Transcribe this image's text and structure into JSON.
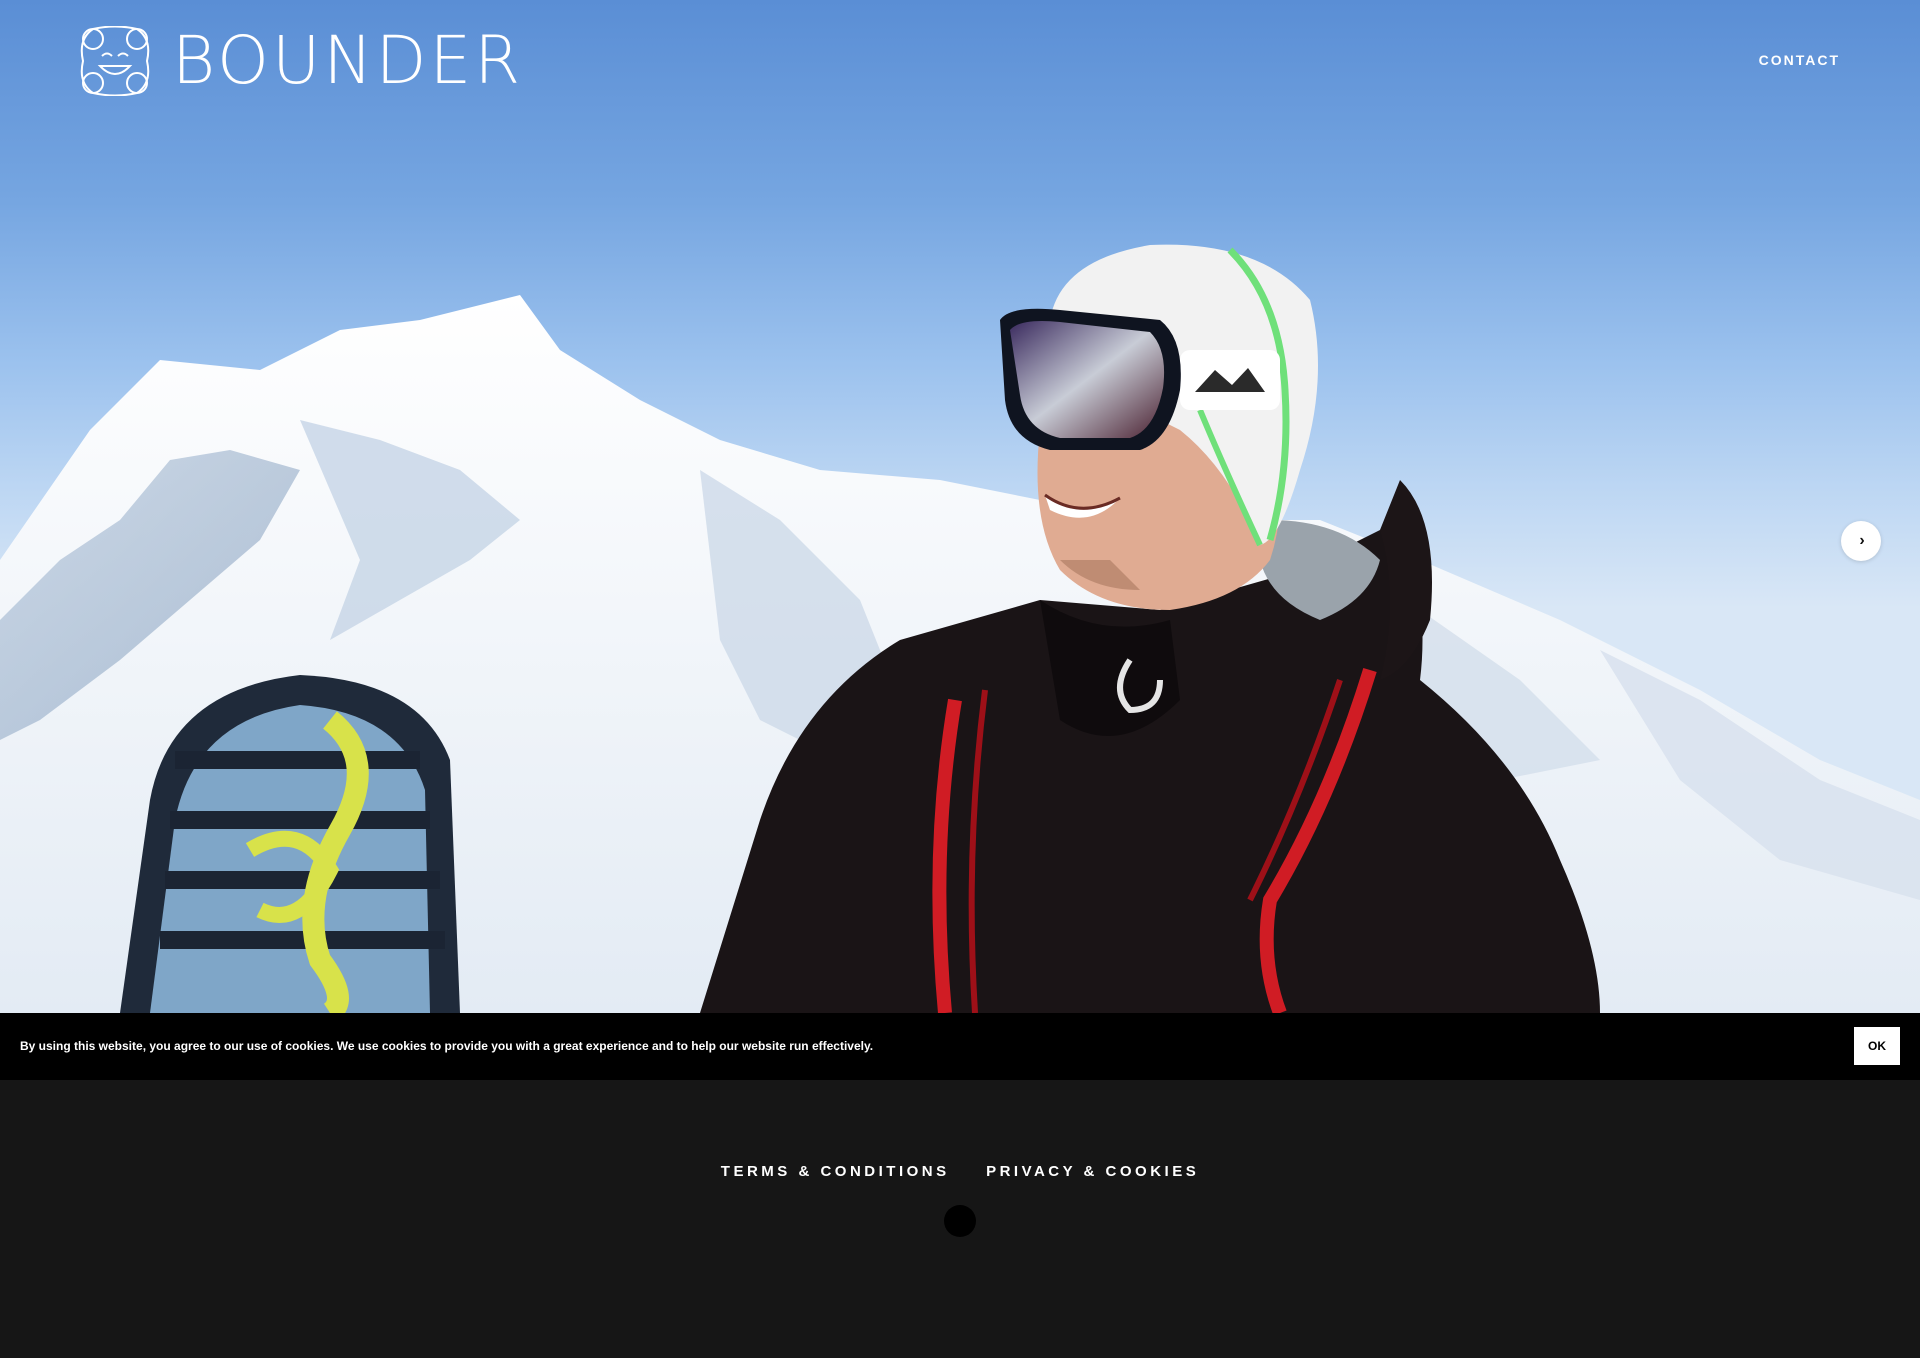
{
  "brand": {
    "name": "BOUNDER",
    "logo_icon": "bounder-face-icon"
  },
  "nav": {
    "contact": "CONTACT"
  },
  "hero": {
    "next_icon": "chevron-right-icon",
    "next_glyph": "›"
  },
  "cookie_banner": {
    "message": "By using this website, you agree to our use of cookies. We use cookies to provide you with a great experience and to help our website run effectively.",
    "ok_label": "OK"
  },
  "footer": {
    "links": [
      "TERMS & CONDITIONS",
      "PRIVACY & COOKIES"
    ]
  },
  "colors": {
    "background": "#161616",
    "cookie_bar": "#000000",
    "sky_top": "#5a8ed5",
    "text": "#ffffff"
  }
}
